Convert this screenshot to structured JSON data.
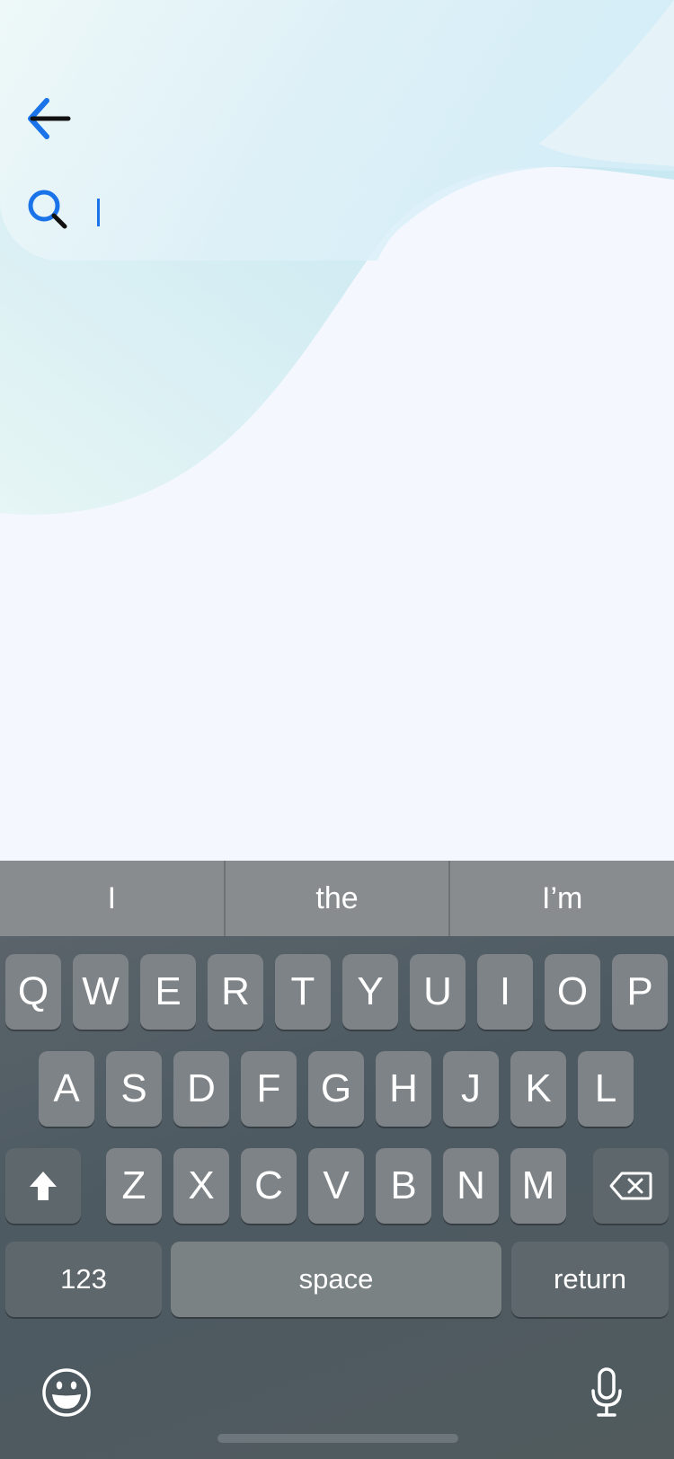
{
  "colors": {
    "accent": "#1a73e8",
    "page_background": "#f4f8fe",
    "keyboard_key": "#7e8387",
    "prediction_bar": "#898c8f"
  },
  "header": {
    "back_icon": "arrow-left-icon",
    "search_icon": "magnifier-icon"
  },
  "search": {
    "value": "",
    "placeholder": ""
  },
  "keyboard": {
    "predictions": [
      "I",
      "the",
      "I’m"
    ],
    "rows": [
      [
        "Q",
        "W",
        "E",
        "R",
        "T",
        "Y",
        "U",
        "I",
        "O",
        "P"
      ],
      [
        "A",
        "S",
        "D",
        "F",
        "G",
        "H",
        "J",
        "K",
        "L"
      ],
      [
        "Z",
        "X",
        "C",
        "V",
        "B",
        "N",
        "M"
      ]
    ],
    "shift_icon": "shift-icon",
    "delete_icon": "delete-backspace-icon",
    "numbers_label": "123",
    "space_label": "space",
    "return_label": "return",
    "emoji_icon": "emoji-icon",
    "mic_icon": "microphone-icon"
  }
}
